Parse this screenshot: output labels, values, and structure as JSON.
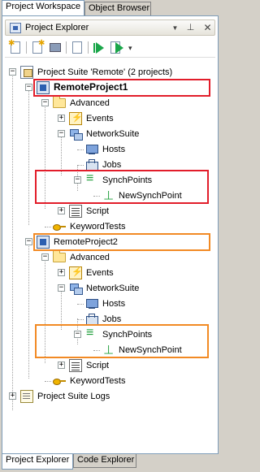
{
  "top_tabs": [
    {
      "label": "Project Workspace",
      "active": true
    },
    {
      "label": "Object Browser",
      "active": false
    }
  ],
  "panel": {
    "title": "Project Explorer",
    "title_buttons": [
      "dropdown-arrow-icon",
      "pin-icon",
      "close-icon"
    ]
  },
  "toolbar": {
    "icons": [
      "add-new-item-icon",
      "new-document-icon",
      "save-icon",
      "properties-icon",
      "run-icon",
      "run-selected-icon",
      "dropdown-arrow-icon"
    ]
  },
  "tree": {
    "suite": "Project Suite 'Remote' (2 projects)",
    "project1": {
      "name": "RemoteProject1",
      "advanced": "Advanced",
      "events": "Events",
      "network_suite": "NetworkSuite",
      "hosts": "Hosts",
      "jobs": "Jobs",
      "synch_points": "SynchPoints",
      "new_synch_point": "NewSynchPoint",
      "script": "Script",
      "keyword_tests": "KeywordTests"
    },
    "project2": {
      "name": "RemoteProject2",
      "advanced": "Advanced",
      "events": "Events",
      "network_suite": "NetworkSuite",
      "hosts": "Hosts",
      "jobs": "Jobs",
      "synch_points": "SynchPoints",
      "new_synch_point": "NewSynchPoint",
      "script": "Script",
      "keyword_tests": "KeywordTests"
    },
    "logs": "Project Suite Logs"
  },
  "highlight_colors": {
    "red": "#e21d2a",
    "orange": "#f28a24"
  },
  "bottom_tabs": [
    {
      "label": "Project Explorer",
      "active": true
    },
    {
      "label": "Code Explorer",
      "active": false
    }
  ]
}
